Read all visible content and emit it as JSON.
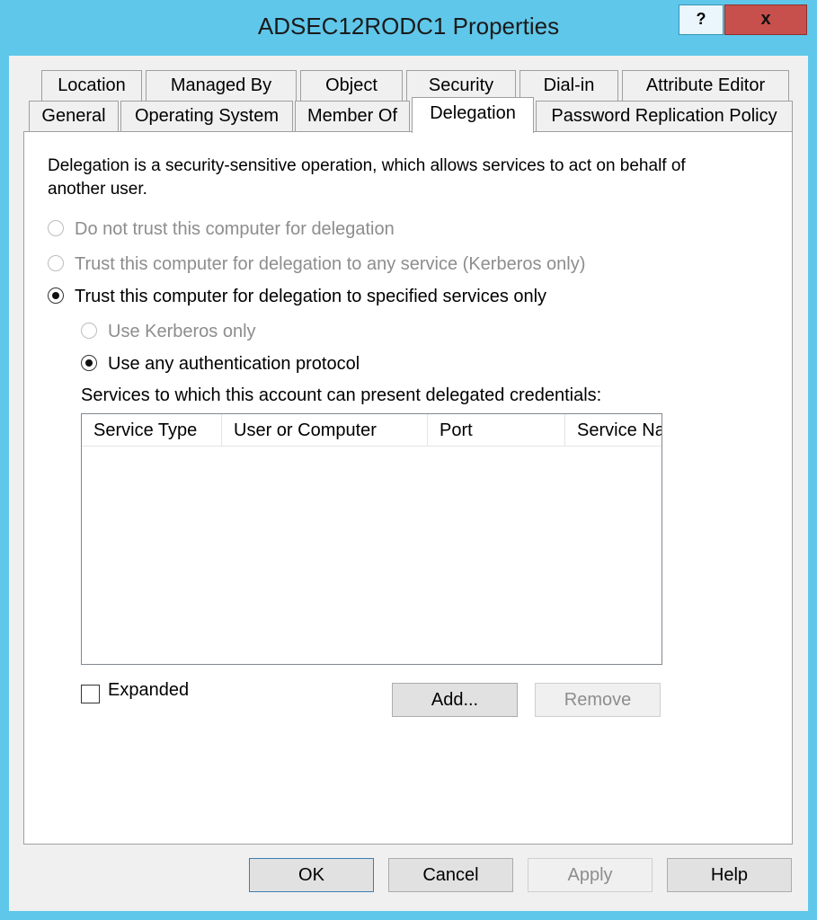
{
  "window": {
    "title": "ADSEC12RODC1 Properties",
    "help_label": "?",
    "close_label": "x"
  },
  "tabs": {
    "row1": [
      "Location",
      "Managed By",
      "Object",
      "Security",
      "Dial-in",
      "Attribute Editor"
    ],
    "row2": [
      "General",
      "Operating System",
      "Member Of",
      "Delegation",
      "Password Replication Policy"
    ],
    "active": "Delegation"
  },
  "delegation": {
    "description": "Delegation is a security-sensitive operation, which allows services to act on behalf of another user.",
    "options": [
      {
        "label": "Do not trust this computer for delegation",
        "selected": false,
        "enabled": false
      },
      {
        "label": "Trust this computer for delegation to any service (Kerberos only)",
        "selected": false,
        "enabled": false
      },
      {
        "label": "Trust this computer for delegation to specified services only",
        "selected": true,
        "enabled": true
      }
    ],
    "sub_options": [
      {
        "label": "Use Kerberos only",
        "selected": false,
        "enabled": false
      },
      {
        "label": "Use any authentication protocol",
        "selected": true,
        "enabled": true
      }
    ],
    "services_label": "Services to which this account can present delegated credentials:",
    "services_table": {
      "columns": [
        "Service Type",
        "User or Computer",
        "Port",
        "Service Na"
      ],
      "rows": []
    },
    "expanded_label": "Expanded",
    "expanded_checked": false,
    "add_label": "Add...",
    "remove_label": "Remove"
  },
  "footer": {
    "ok_label": "OK",
    "cancel_label": "Cancel",
    "apply_label": "Apply",
    "help_label": "Help"
  },
  "colors": {
    "frame": "#5fc7ea",
    "close": "#c7504c",
    "dialog_bg": "#f0f0f0",
    "panel_bg": "#ffffff"
  }
}
